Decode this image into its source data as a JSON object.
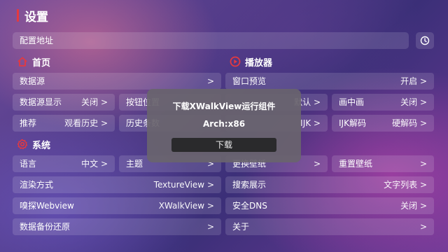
{
  "title": "设置",
  "config_address": "配置地址",
  "home": {
    "heading": "首页",
    "rows": [
      {
        "label": "数据源",
        "value": ">"
      },
      {
        "label": "数据源显示",
        "value": "关闭 >"
      },
      {
        "label": "按钮位置",
        "value": ""
      },
      {
        "label": "推荐",
        "value": "观看历史 >"
      },
      {
        "label": "历史条数",
        "value": ""
      }
    ]
  },
  "player": {
    "heading": "播放器",
    "rows": [
      {
        "label": "窗口预览",
        "value": "开启 >"
      },
      {
        "label": "",
        "value": "默认 >"
      },
      {
        "label": "画中画",
        "value": "关闭 >"
      },
      {
        "label": "",
        "value": "IJK >"
      },
      {
        "label": "IJK解码",
        "value": "硬解码 >"
      }
    ]
  },
  "system": {
    "heading": "系统",
    "rows": [
      {
        "label": "语言",
        "value": "中文 >"
      },
      {
        "label": "主题",
        "value": ">"
      },
      {
        "label": "更换壁纸",
        "value": ">"
      },
      {
        "label": "重置壁纸",
        "value": ">"
      },
      {
        "label": "渲染方式",
        "value": "TextureView >"
      },
      {
        "label": "搜索展示",
        "value": "文字列表 >"
      },
      {
        "label": "嗅探Webview",
        "value": "XWalkView >"
      },
      {
        "label": "安全DNS",
        "value": "关闭 >"
      },
      {
        "label": "数据备份还原",
        "value": ">"
      },
      {
        "label": "关于",
        "value": ">"
      }
    ]
  },
  "dialog": {
    "title": "下载XWalkView运行组件",
    "arch": "Arch:x86",
    "button": "下载"
  },
  "colors": {
    "accent": "#e5393f"
  },
  "icons": {
    "history": "history-icon",
    "home": "home-icon",
    "play": "play-circle-icon",
    "gear": "gear-icon"
  }
}
